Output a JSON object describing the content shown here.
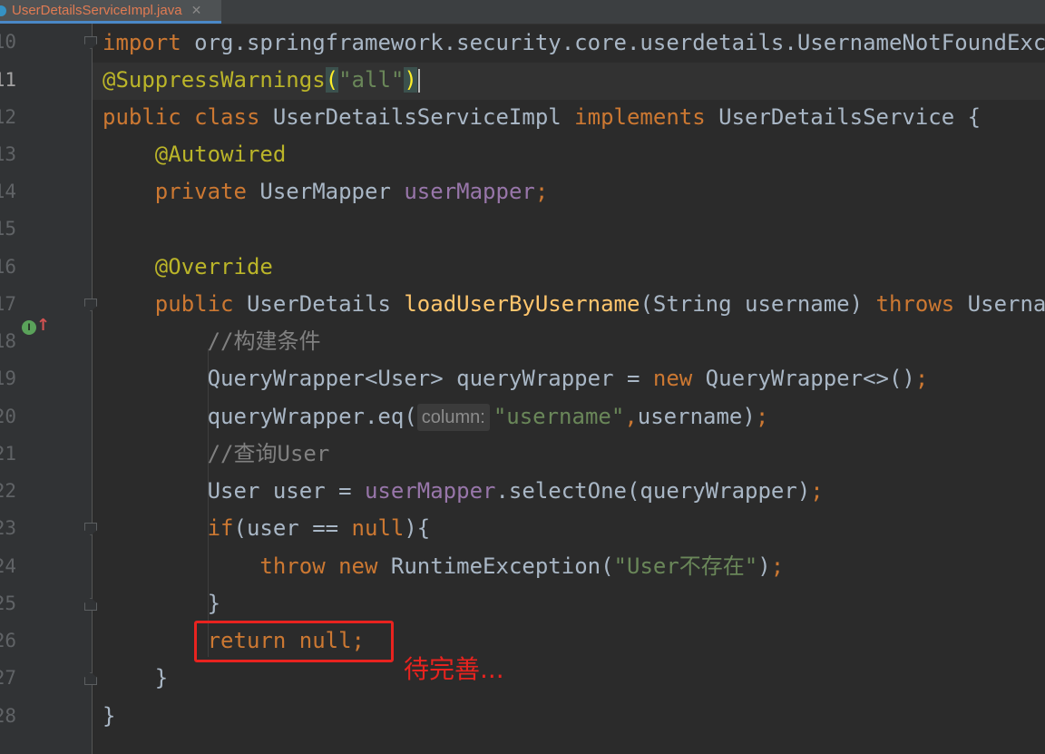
{
  "tab": {
    "filename": "UserDetailsServiceImpl.java",
    "close": "✕"
  },
  "line_numbers": [
    "10",
    "11",
    "12",
    "13",
    "14",
    "15",
    "16",
    "17",
    "18",
    "19",
    "20",
    "21",
    "22",
    "23",
    "24",
    "25",
    "26",
    "27",
    "28"
  ],
  "code": {
    "l1": {
      "import": "import",
      "pkg": " org.springframework.security.core.userdetails.UsernameNotFoundException;"
    },
    "l2": {
      "ann": "@SuppressWarnings",
      "p1": "(",
      "str": "\"all\"",
      "p2": ")"
    },
    "l3": {
      "k1": "public class",
      "t1": " UserDetailsServiceImpl ",
      "k2": "implements",
      "t2": " UserDetailsService {"
    },
    "l4": {
      "ann": "    @Autowired"
    },
    "l5": {
      "k": "    private",
      "t": " UserMapper ",
      "f": "userMapper",
      "s": ";"
    },
    "l7": {
      "ann": "    @Override"
    },
    "l8": {
      "k1": "    public",
      "t1": " UserDetails ",
      "m": "loadUserByUsername",
      "t2": "(String username) ",
      "k2": "throws",
      "t3": " UsernameNotFoundException {"
    },
    "l9": {
      "c": "        //构建条件"
    },
    "l10": {
      "t1": "        QueryWrapper<User> queryWrapper = ",
      "k": "new",
      "t2": " QueryWrapper<>()",
      "s": ";"
    },
    "l11": {
      "t1": "        queryWrapper.eq(",
      "hint": "column:",
      "str": "\"username\"",
      "k": ",",
      "t2": "username)",
      "s": ";"
    },
    "l12": {
      "c": "        //查询User"
    },
    "l13": {
      "t1": "        User user = ",
      "f": "userMapper",
      "t2": ".selectOne(queryWrapper)",
      "s": ";"
    },
    "l14": {
      "k1": "        if",
      "t1": "(user == ",
      "k2": "null",
      "t2": "){"
    },
    "l15": {
      "k1": "            throw",
      "sp": " ",
      "k2": "new",
      "t1": " RuntimeException(",
      "str": "\"User不存在\"",
      "t2": ")",
      "s": ";"
    },
    "l16": {
      "t": "        }"
    },
    "l17": {
      "k": "        return null",
      "s": ";"
    },
    "l18": {
      "t": "    }"
    },
    "l19": {
      "t": "}"
    }
  },
  "annotation": {
    "note": "待完善..."
  },
  "colors": {
    "keyword": "#cc7832",
    "annotation": "#bbb529",
    "string": "#6a8759",
    "field": "#9876aa",
    "method": "#ffc66d",
    "comment": "#808080",
    "highlight": "#e8231f"
  }
}
